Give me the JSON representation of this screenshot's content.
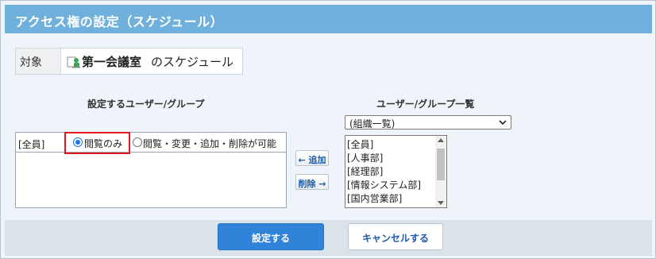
{
  "dialog": {
    "title": "アクセス権の設定（スケジュール）"
  },
  "target": {
    "label": "対象",
    "facility_name": "第一会議室",
    "suffix": "のスケジュール",
    "icon": "meeting-room-icon"
  },
  "left_panel": {
    "heading": "設定するユーザー/グループ",
    "rows": [
      {
        "who": "[全員]",
        "options": [
          "閲覧のみ",
          "閲覧・変更・追加・削除が可能"
        ],
        "selected": "閲覧のみ"
      }
    ]
  },
  "transfer": {
    "add_label": "← 追加",
    "remove_label": "削除 →"
  },
  "right_panel": {
    "heading": "ユーザー/グループ一覧",
    "select_value": "(組織一覧)",
    "items": [
      "[全員]",
      "[人事部]",
      "[経理部]",
      "[情報システム部]",
      "[国内営業部]"
    ]
  },
  "footer": {
    "submit_label": "設定する",
    "cancel_label": "キャンセルする"
  },
  "colors": {
    "title_bar": "#6fb0dc",
    "primary_button": "#2f84d9",
    "highlight": "#e0191f"
  }
}
